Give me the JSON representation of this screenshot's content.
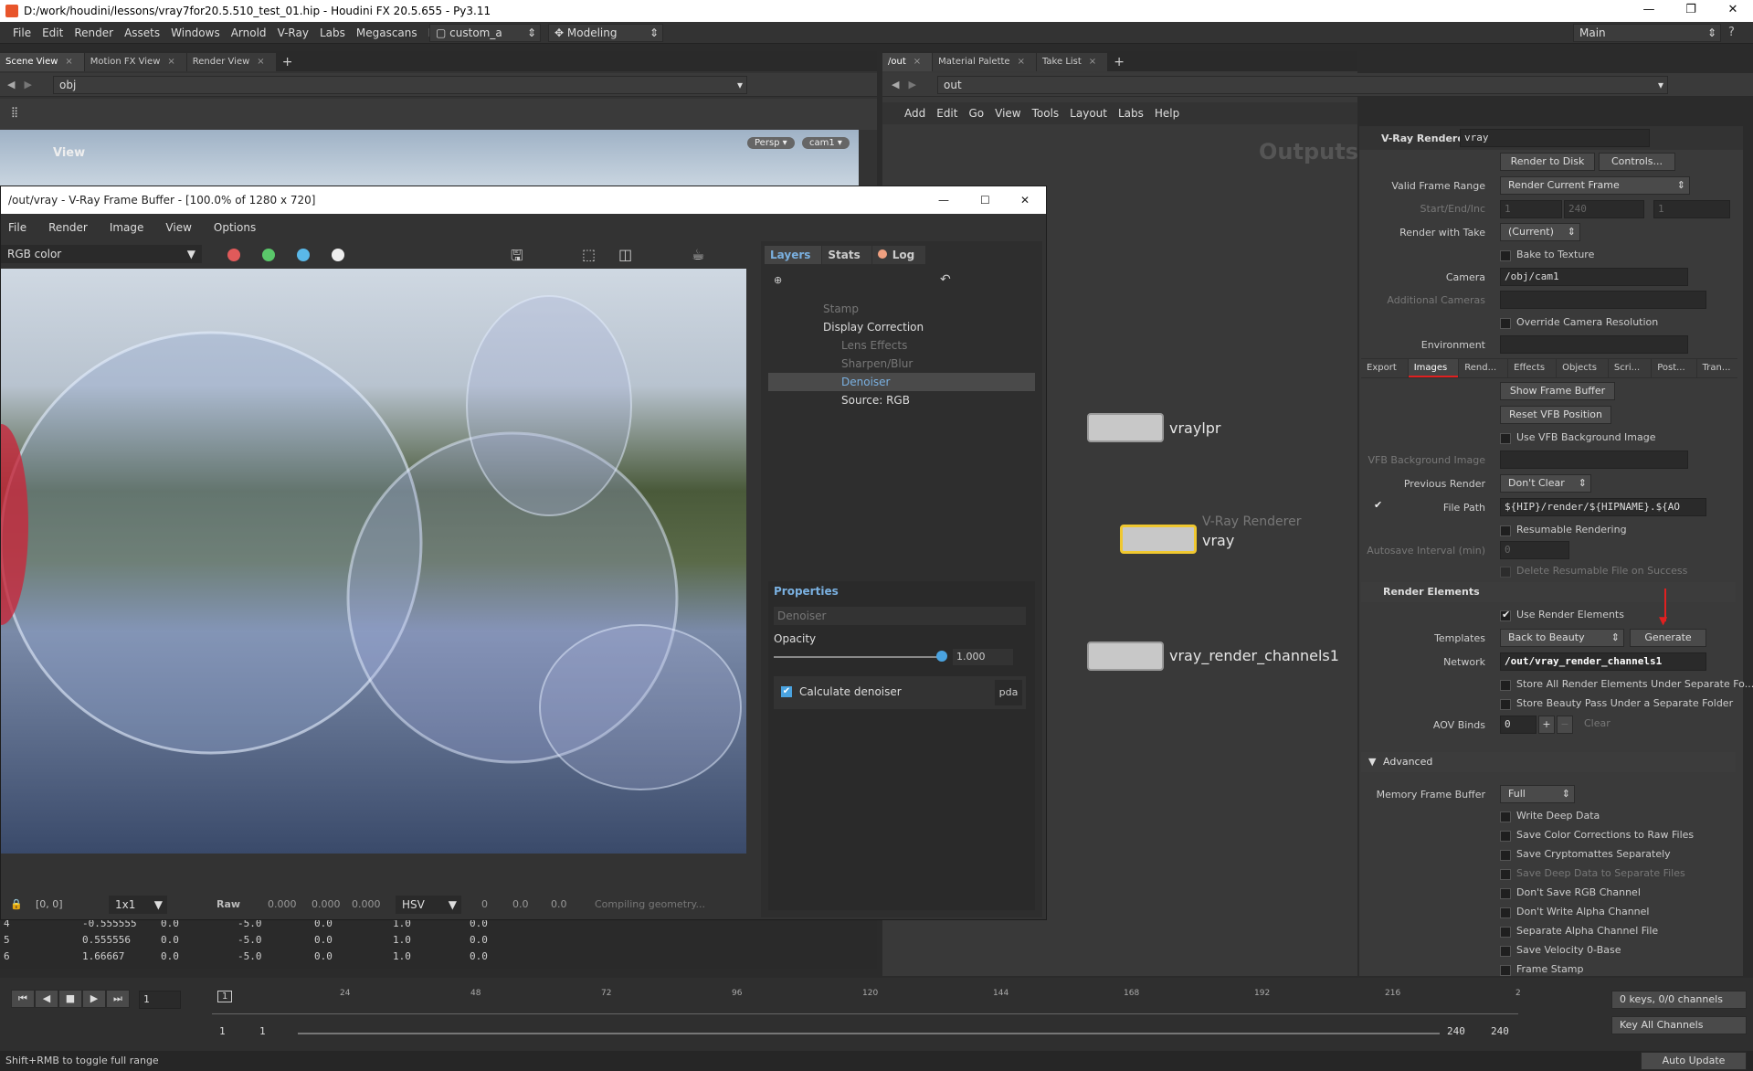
{
  "window": {
    "title": "D:/work/houdini/lessons/vray7for20.5.510_test_01.hip - Houdini FX 20.5.655 - Py3.11",
    "ctl_min": "—",
    "ctl_max": "❐",
    "ctl_close": "✕"
  },
  "menubar": {
    "items": [
      "File",
      "Edit",
      "Render",
      "Assets",
      "Windows",
      "Arnold",
      "V-Ray",
      "Labs",
      "Megascans",
      "Help"
    ],
    "desktop": "custom_a",
    "context": "Modeling",
    "main": "Main"
  },
  "left_pane": {
    "tabs": [
      "Scene View",
      "Motion FX View",
      "Render View"
    ],
    "path": "obj",
    "view_label": "View",
    "persp": "Persp ▾",
    "cam": "cam1 ▾"
  },
  "right_top": {
    "tabs": [
      "/out",
      "Material Palette",
      "Take List"
    ],
    "path": "out",
    "menu": [
      "Add",
      "Edit",
      "Go",
      "View",
      "Tools",
      "Layout",
      "Labs",
      "Help"
    ],
    "net_title": "Outputs"
  },
  "vfb": {
    "title": "/out/vray - V-Ray Frame Buffer - [100.0% of 1280 x 720]",
    "menu": [
      "File",
      "Render",
      "Image",
      "View",
      "Options"
    ],
    "channel": "RGB color",
    "layer_tabs": [
      "Layers",
      "Stats",
      "Log"
    ],
    "layers": [
      {
        "name": "Stamp",
        "state": "dim"
      },
      {
        "name": "Display Correction",
        "state": "on"
      },
      {
        "name": "Lens Effects",
        "state": "dim"
      },
      {
        "name": "Sharpen/Blur",
        "state": "dim"
      },
      {
        "name": "Denoiser",
        "state": "sel"
      },
      {
        "name": "Source: RGB",
        "state": "on"
      }
    ],
    "props": {
      "tab": "Properties",
      "layer": "Denoiser",
      "opacity_label": "Opacity",
      "opacity_value": "1.000",
      "opacity": 1.0,
      "calc_label": "Calculate denoiser",
      "calc_mode": "pda"
    },
    "status": {
      "coord": "[0, 0]",
      "zoom": "1x1",
      "raw": "Raw",
      "v1": "0.000",
      "v2": "0.000",
      "v3": "0.000",
      "space": "HSV",
      "h": "0",
      "s": "0.0",
      "v": "0.0",
      "msg": "Compiling geometry..."
    }
  },
  "spreadsheet": {
    "rows": [
      [
        "4",
        "-0.555555",
        "0.0",
        "-5.0",
        "0.0",
        "1.0",
        "0.0"
      ],
      [
        "5",
        "0.555556",
        "0.0",
        "-5.0",
        "0.0",
        "1.0",
        "0.0"
      ],
      [
        "6",
        "1.66667",
        "0.0",
        "-5.0",
        "0.0",
        "1.0",
        "0.0"
      ]
    ]
  },
  "nodes": {
    "vraylpr": "vraylpr",
    "vray_type": "V-Ray Renderer",
    "vray": "vray",
    "channels": "vray_render_channels1"
  },
  "params": {
    "header_type": "V-Ray Renderer",
    "header_name": "vray",
    "render_to_disk": "Render to Disk",
    "controls": "Controls...",
    "valid_frame_range_lbl": "Valid Frame Range",
    "valid_frame_range": "Render Current Frame",
    "start_end_lbl": "Start/End/Inc",
    "start": "1",
    "end": "240",
    "inc": "1",
    "take_lbl": "Render with Take",
    "take": "(Current)",
    "bake": "Bake to Texture",
    "camera_lbl": "Camera",
    "camera": "/obj/cam1",
    "add_cam_lbl": "Additional Cameras",
    "override_res": "Override Camera Resolution",
    "env_lbl": "Environment",
    "tabs": [
      "Export",
      "Images",
      "Rend...",
      "Effects",
      "Objects",
      "Scri...",
      "Post...",
      "Tran..."
    ],
    "show_fb": "Show Frame Buffer",
    "reset_vfb": "Reset VFB Position",
    "use_vfb_bg": "Use VFB Background Image",
    "vfb_bg_lbl": "VFB Background Image",
    "prev_render_lbl": "Previous Render",
    "prev_render": "Don't Clear",
    "file_path_lbl": "File Path",
    "file_path": "${HIP}/render/${HIPNAME}.${AO",
    "resumable": "Resumable Rendering",
    "autosave_lbl": "Autosave Interval (min)",
    "autosave": "0",
    "delete_resumable": "Delete Resumable File on Success",
    "render_elements": "Render Elements",
    "use_re": "Use Render Elements",
    "templates_lbl": "Templates",
    "templates": "Back to Beauty",
    "generate": "Generate",
    "network_lbl": "Network",
    "network": "/out/vray_render_channels1",
    "store_all": "Store All Render Elements Under Separate Fo...",
    "store_beauty": "Store Beauty Pass Under a Separate Folder",
    "aov_lbl": "AOV Binds",
    "aov": "0",
    "clear": "Clear",
    "advanced": "Advanced",
    "mem_fb_lbl": "Memory Frame Buffer",
    "mem_fb": "Full",
    "checks": [
      "Write Deep Data",
      "Save Color Corrections to Raw Files",
      "Save Cryptomattes Separately",
      "Save Deep Data to Separate Files",
      "Don't Save RGB Channel",
      "Don't Write Alpha Channel",
      "Separate Alpha Channel File",
      "Save Velocity 0-Base",
      "Frame Stamp"
    ]
  },
  "timeline": {
    "frame": "1",
    "ticks": [
      "24",
      "48",
      "72",
      "96",
      "120",
      "144",
      "168",
      "192",
      "216",
      "2"
    ],
    "range_start": "1",
    "range_start2": "1",
    "range_end": "240",
    "range_end2": "240",
    "keys": "0 keys, 0/0 channels",
    "key_all": "Key All Channels",
    "auto_update": "Auto Update",
    "status": "Shift+RMB to toggle full range"
  },
  "colors": {
    "accent_red": "#e02020",
    "accent_blue": "#4aa3e0",
    "node_select": "#f0c830"
  }
}
